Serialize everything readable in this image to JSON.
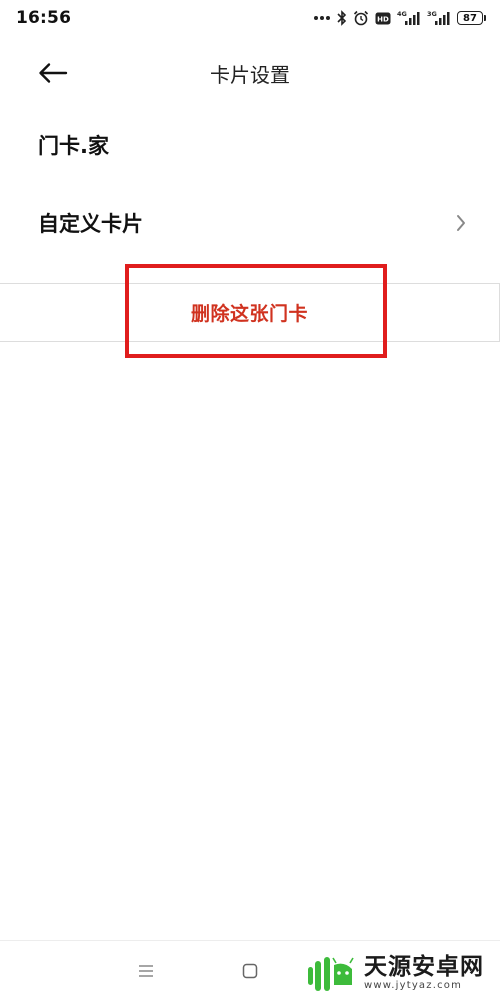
{
  "status_bar": {
    "time": "16:56",
    "network_4g": "4G",
    "network_3g": "3G",
    "hd_badge": "HD",
    "battery": "87",
    "icons": [
      "more-dots-icon",
      "bluetooth-icon",
      "alarm-icon",
      "hd-icon",
      "signal-4g-icon",
      "signal-3g-icon",
      "battery-icon"
    ]
  },
  "header": {
    "title": "卡片设置",
    "back_icon": "back-arrow-icon"
  },
  "rows": {
    "card_name": "门卡.家",
    "custom_card": "自定义卡片"
  },
  "delete_button": {
    "label": "删除这张门卡",
    "color": "#d0321f"
  },
  "highlight": {
    "color": "#e01d1d"
  },
  "nav_bar": {
    "icons": [
      "menu-icon",
      "home-icon"
    ]
  },
  "watermark": {
    "title": "天源安卓网",
    "url": "www.jytyaz.com"
  }
}
